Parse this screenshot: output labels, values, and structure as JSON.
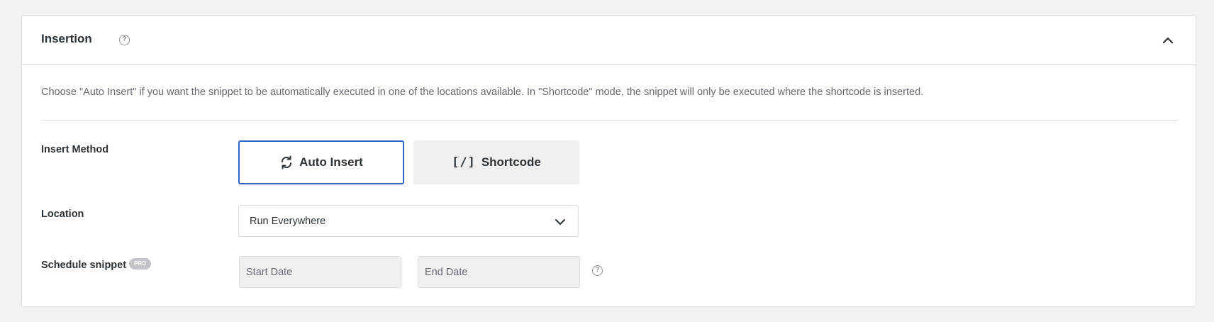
{
  "panel": {
    "title": "Insertion",
    "help_icon": "question-circle-icon",
    "collapse_icon": "chevron-up-icon"
  },
  "description": "Choose \"Auto Insert\" if you want the snippet to be automatically executed in one of the locations available. In \"Shortcode\" mode, the snippet will only be executed where the shortcode is inserted.",
  "insert_method": {
    "label": "Insert Method",
    "options": [
      {
        "label": "Auto Insert",
        "icon": "refresh-icon",
        "selected": true
      },
      {
        "label": "Shortcode",
        "icon": "[/]",
        "selected": false
      }
    ]
  },
  "location": {
    "label": "Location",
    "value": "Run Everywhere",
    "icon": "chevron-down-icon"
  },
  "schedule": {
    "label": "Schedule snippet",
    "badge": "PRO",
    "start_placeholder": "Start Date",
    "end_placeholder": "End Date",
    "help_icon": "question-circle-icon"
  },
  "colors": {
    "accent": "#2f63c8",
    "page_background": "#f1f2f4",
    "panel_background": "#ffffff",
    "border": "#dcdde1",
    "inactive_button": "#f0f0f1",
    "badge": "#c3c4c7"
  }
}
